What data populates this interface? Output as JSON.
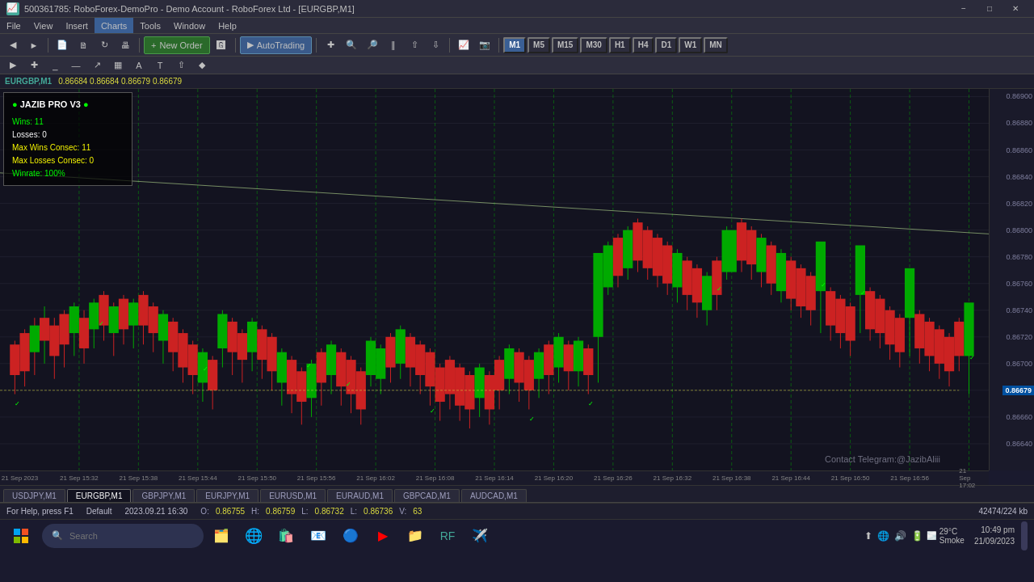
{
  "window": {
    "title": "500361785: RoboForex-DemoPro - Demo Account - RoboForex Ltd - [EURGBP,M1]",
    "app_icon": "📈"
  },
  "menu": {
    "items": [
      "File",
      "View",
      "Insert",
      "Charts",
      "Tools",
      "Window",
      "Help"
    ]
  },
  "toolbar": {
    "new_order_label": "New Order",
    "autotrade_label": "AutoTrading",
    "timeframes": [
      "M1",
      "M5",
      "M15",
      "M30",
      "H1",
      "H4",
      "D1",
      "W1",
      "MN"
    ],
    "active_timeframe": "M1"
  },
  "symbol_bar": {
    "symbol": "EURGBP,M1",
    "prices": "0.86684 0.86684 0.86679 0.86679"
  },
  "ea_panel": {
    "name": "JAZIB PRO V3",
    "wins_label": "Wins:",
    "wins_value": "11",
    "losses_label": "Losses:",
    "losses_value": "0",
    "max_wins_label": "Max Wins Consec:",
    "max_wins_value": "11",
    "max_losses_label": "Max Losses Consec:",
    "max_losses_value": "0",
    "winrate_label": "Winrate:",
    "winrate_value": "100%"
  },
  "price_levels": [
    {
      "price": "0.86900",
      "y_pct": 2
    },
    {
      "price": "0.86880",
      "y_pct": 9
    },
    {
      "price": "0.86860",
      "y_pct": 16
    },
    {
      "price": "0.86840",
      "y_pct": 23
    },
    {
      "price": "0.86820",
      "y_pct": 30
    },
    {
      "price": "0.86800",
      "y_pct": 37
    },
    {
      "price": "0.86780",
      "y_pct": 44
    },
    {
      "price": "0.86760",
      "y_pct": 51
    },
    {
      "price": "0.86740",
      "y_pct": 58
    },
    {
      "price": "0.86720",
      "y_pct": 65
    },
    {
      "price": "0.86700",
      "y_pct": 72
    },
    {
      "price": "0.86680",
      "y_pct": 79
    },
    {
      "price": "0.86660",
      "y_pct": 86
    },
    {
      "price": "0.86640",
      "y_pct": 93
    }
  ],
  "current_price": {
    "value": "0.86679",
    "y_pct": 80
  },
  "time_labels": [
    {
      "time": "21 Sep 2023",
      "x_pct": 2
    },
    {
      "time": "21 Sep 15:32",
      "x_pct": 8
    },
    {
      "time": "21 Sep 15:38",
      "x_pct": 14
    },
    {
      "time": "21 Sep 15:44",
      "x_pct": 20
    },
    {
      "time": "21 Sep 15:50",
      "x_pct": 26
    },
    {
      "time": "21 Sep 15:56",
      "x_pct": 32
    },
    {
      "time": "21 Sep 16:02",
      "x_pct": 38
    },
    {
      "time": "21 Sep 16:08",
      "x_pct": 44
    },
    {
      "time": "21 Sep 16:14",
      "x_pct": 50
    },
    {
      "time": "21 Sep 16:20",
      "x_pct": 56
    },
    {
      "time": "21 Sep 16:26",
      "x_pct": 62
    },
    {
      "time": "21 Sep 16:32",
      "x_pct": 68
    },
    {
      "time": "21 Sep 16:38",
      "x_pct": 74
    },
    {
      "time": "21 Sep 16:44",
      "x_pct": 80
    },
    {
      "time": "21 Sep 16:50",
      "x_pct": 86
    },
    {
      "time": "21 Sep 16:56",
      "x_pct": 92
    },
    {
      "time": "21 Sep 17:02",
      "x_pct": 98
    }
  ],
  "tabs": [
    {
      "label": "USDJPY,M1",
      "active": false
    },
    {
      "label": "EURGBP,M1",
      "active": true
    },
    {
      "label": "GBPJPY,M1",
      "active": false
    },
    {
      "label": "EURJPY,M1",
      "active": false
    },
    {
      "label": "EURUSD,M1",
      "active": false
    },
    {
      "label": "EURAUD,M1",
      "active": false
    },
    {
      "label": "GBPCAD,M1",
      "active": false
    },
    {
      "label": "AUDCAD,M1",
      "active": false
    }
  ],
  "status_bar": {
    "help_text": "For Help, press F1",
    "profile": "Default",
    "datetime": "2023.09.21 16:30",
    "open_label": "O:",
    "open_val": "0.86755",
    "high_label": "H:",
    "high_val": "0.86759",
    "low_label": "L:",
    "low_val": "0.86732",
    "close_label": "L:",
    "close_val": "0.86736",
    "volume_label": "V:",
    "volume_val": "63",
    "file_info": "42474/224 kb"
  },
  "taskbar": {
    "search_placeholder": "Search",
    "weather_temp": "29°C",
    "weather_desc": "Smoke",
    "time": "10:49 pm",
    "date": "21/09/2023"
  },
  "watermark": {
    "text": "Contact Telegram:@JazibAliii"
  },
  "colors": {
    "bull": "#00cc00",
    "bear": "#cc2222",
    "background": "#131320",
    "grid": "#1e1e2e",
    "current_price_bg": "#0050a0"
  }
}
